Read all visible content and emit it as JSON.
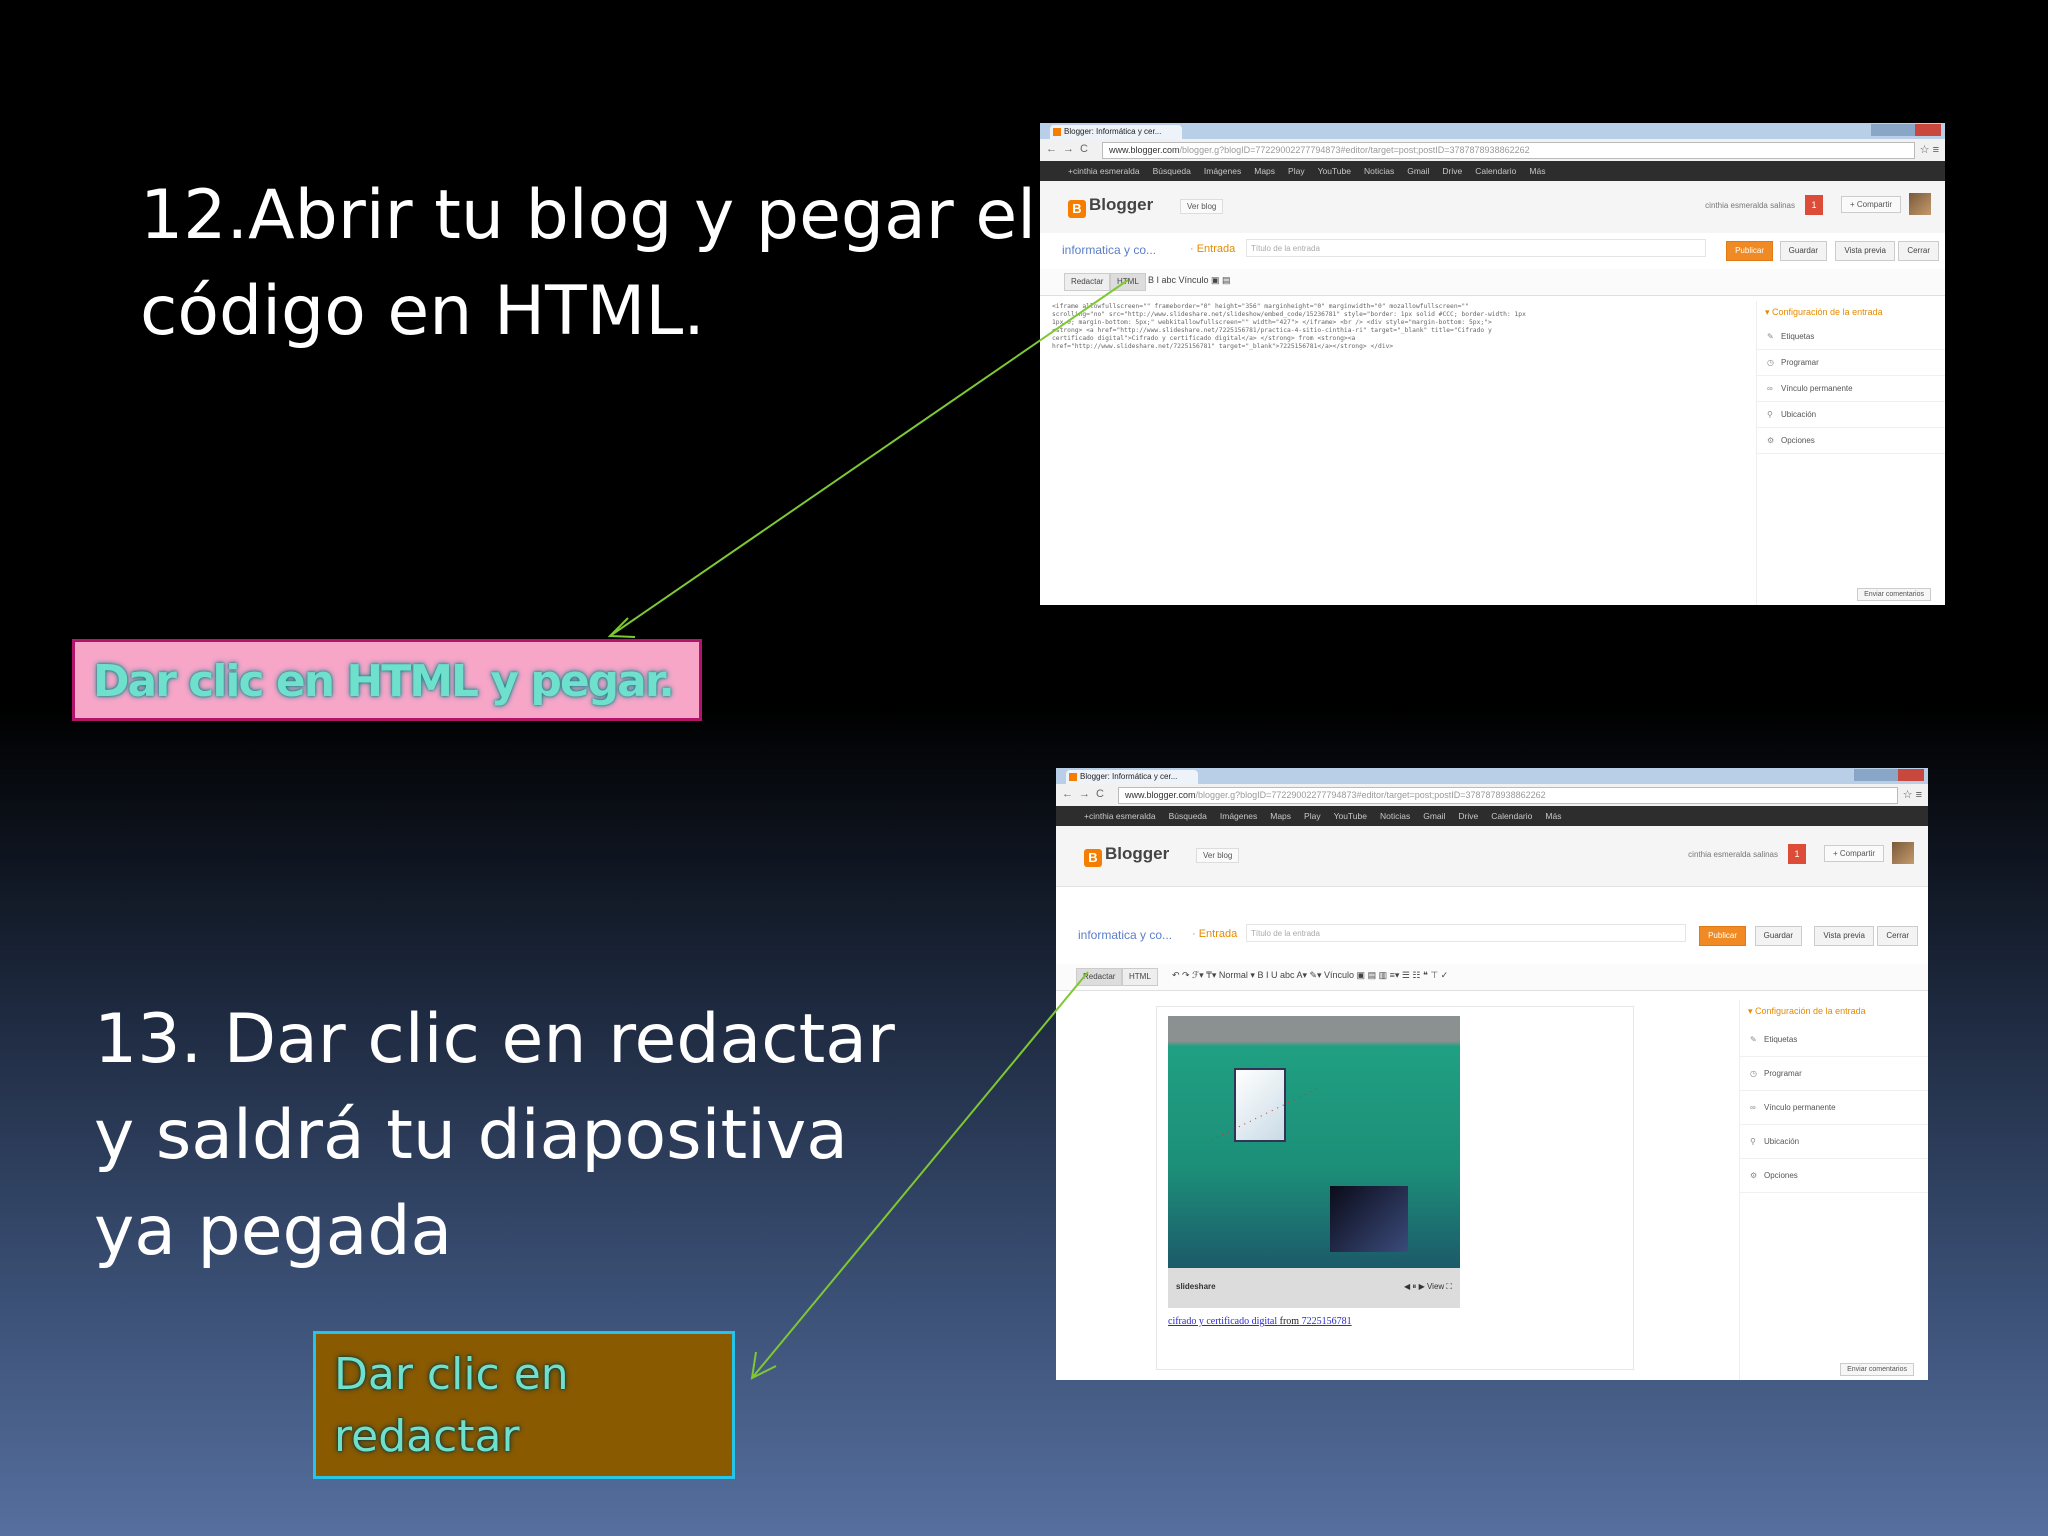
{
  "slide": {
    "step12": {
      "line1": "12.Abrir tu blog y pegar el",
      "line2": "código en HTML."
    },
    "callout1": "Dar clic en HTML y pegar.",
    "step13": {
      "line1": "13. Dar clic en redactar",
      "line2": "y saldrá tu diapositiva",
      "line3": "ya pegada"
    },
    "callout2": {
      "line1": "Dar clic en",
      "line2": "redactar"
    },
    "arrow_color": "#7ec832"
  },
  "screenshot1": {
    "tab": "Blogger: Informática y cer...",
    "url_host": "www.blogger.com",
    "url_rest": "/blogger.g?blogID=77229002277794873#editor/target=post;postID=3787878938862262",
    "gbar": [
      "+cinthia esmeralda",
      "Búsqueda",
      "Imágenes",
      "Maps",
      "Play",
      "YouTube",
      "Noticias",
      "Gmail",
      "Drive",
      "Calendario",
      "Más"
    ],
    "logo": "Blogger",
    "ver_blog": "Ver blog",
    "user": "cinthia esmeralda salinas",
    "notif": "1",
    "share": "+ Compartir",
    "blog_name": "informatica y co...",
    "entrada": "· Entrada",
    "title_placeholder": "Título de la entrada",
    "buttons": [
      "Publicar",
      "Guardar",
      "Vista previa",
      "Cerrar"
    ],
    "modes": [
      "Redactar",
      "HTML"
    ],
    "tools": "B  I  abc  Vínculo  ▣  ▤",
    "code": [
      "<iframe allowfullscreen=\"\" frameborder=\"0\" height=\"356\" marginheight=\"0\" marginwidth=\"0\" mozallowfullscreen=\"\"",
      "scrolling=\"no\" src=\"http://www.slideshare.net/slideshow/embed_code/15236781\" style=\"border: 1px solid #CCC; border-width: 1px",
      "1px 0; margin-bottom: 5px;\" webkitallowfullscreen=\"\" width=\"427\"> </iframe> <br /> <div style=\"margin-bottom: 5px;\">",
      "<strong> <a href=\"http://www.slideshare.net/7225156781/practica-4-sitio-cinthia-ri\" target=\"_blank\" title=\"Cifrado y",
      "certificado digital\">Cifrado y certificado digital</a> </strong> from <strong><a",
      "href=\"http://www.slideshare.net/7225156781\" target=\"_blank\">7225156781</a></strong> </div>"
    ],
    "side_title": "▾ Configuración de la entrada",
    "side_items": [
      "Etiquetas",
      "Programar",
      "Vínculo permanente",
      "Ubicación",
      "Opciones"
    ],
    "side_icons": [
      "✎",
      "◷",
      "∞",
      "⚲",
      "⚙"
    ],
    "footer_btn": "Enviar comentarios"
  },
  "screenshot2": {
    "tab": "Blogger: Informática y cer...",
    "url_host": "www.blogger.com",
    "url_rest": "/blogger.g?blogID=77229002277794873#editor/target=post;postID=3787878938862262",
    "gbar": [
      "+cinthia esmeralda",
      "Búsqueda",
      "Imágenes",
      "Maps",
      "Play",
      "YouTube",
      "Noticias",
      "Gmail",
      "Drive",
      "Calendario",
      "Más"
    ],
    "logo": "Blogger",
    "ver_blog": "Ver blog",
    "user": "cinthia esmeralda salinas",
    "notif": "1",
    "share": "+ Compartir",
    "blog_name": "informatica y co...",
    "entrada": "· Entrada",
    "title_placeholder": "Título de la entrada",
    "buttons": [
      "Publicar",
      "Guardar",
      "Vista previa",
      "Cerrar"
    ],
    "modes": [
      "Redactar",
      "HTML"
    ],
    "tools": "↶ ↷  ℱ▾ ₸▾  Normal ▾  B I U abc A▾ ✎▾  Vínculo ▣ ▤ ▥  ≡▾ ☰ ☷ ❝ ⊤ ✓",
    "player_brand": "slideshare",
    "player_controls": "◀ ⏸ ▶  View  ⛶",
    "link_text": "cifrado y certificado digital",
    "from_text": "from",
    "link_user": "7225156781",
    "side_title": "▾ Configuración de la entrada",
    "side_items": [
      "Etiquetas",
      "Programar",
      "Vínculo permanente",
      "Ubicación",
      "Opciones"
    ],
    "side_icons": [
      "✎",
      "◷",
      "∞",
      "⚲",
      "⚙"
    ],
    "footer_btn": "Enviar comentarios"
  }
}
